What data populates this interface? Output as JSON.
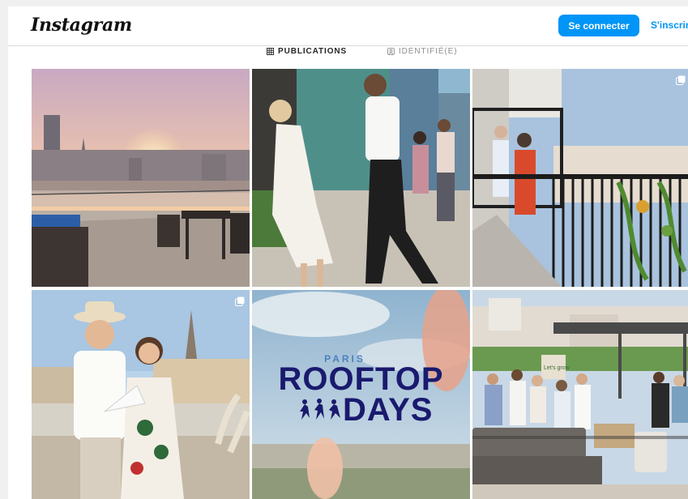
{
  "header": {
    "logo_text": "Instagram",
    "login_button": "Se connecter",
    "signup_link": "S'inscrire"
  },
  "tabs": [
    {
      "label": "PUBLICATIONS",
      "icon": "grid-icon",
      "active": true
    },
    {
      "label": "IDENTIFIÉ(E)",
      "icon": "tagged-icon",
      "active": false
    }
  ],
  "posts": [
    {
      "subject": "rooftop-skyline-sunset",
      "multi": false
    },
    {
      "subject": "couple-dancing-rooftop",
      "multi": false
    },
    {
      "subject": "terrace-railing-guests",
      "multi": true
    },
    {
      "subject": "couple-eiffel-tower",
      "multi": true
    },
    {
      "subject": "paris-rooftop-days-poster",
      "multi": false,
      "poster_small": "PARIS",
      "poster_line1": "ROOFTOP",
      "poster_line2": "DAYS"
    },
    {
      "subject": "rooftop-party-crowd",
      "multi": false,
      "sign_text": "Let's grow"
    }
  ],
  "colors": {
    "accent": "#0095f6",
    "border": "#dbdbdb",
    "poster_navy": "#1a1a6e"
  }
}
